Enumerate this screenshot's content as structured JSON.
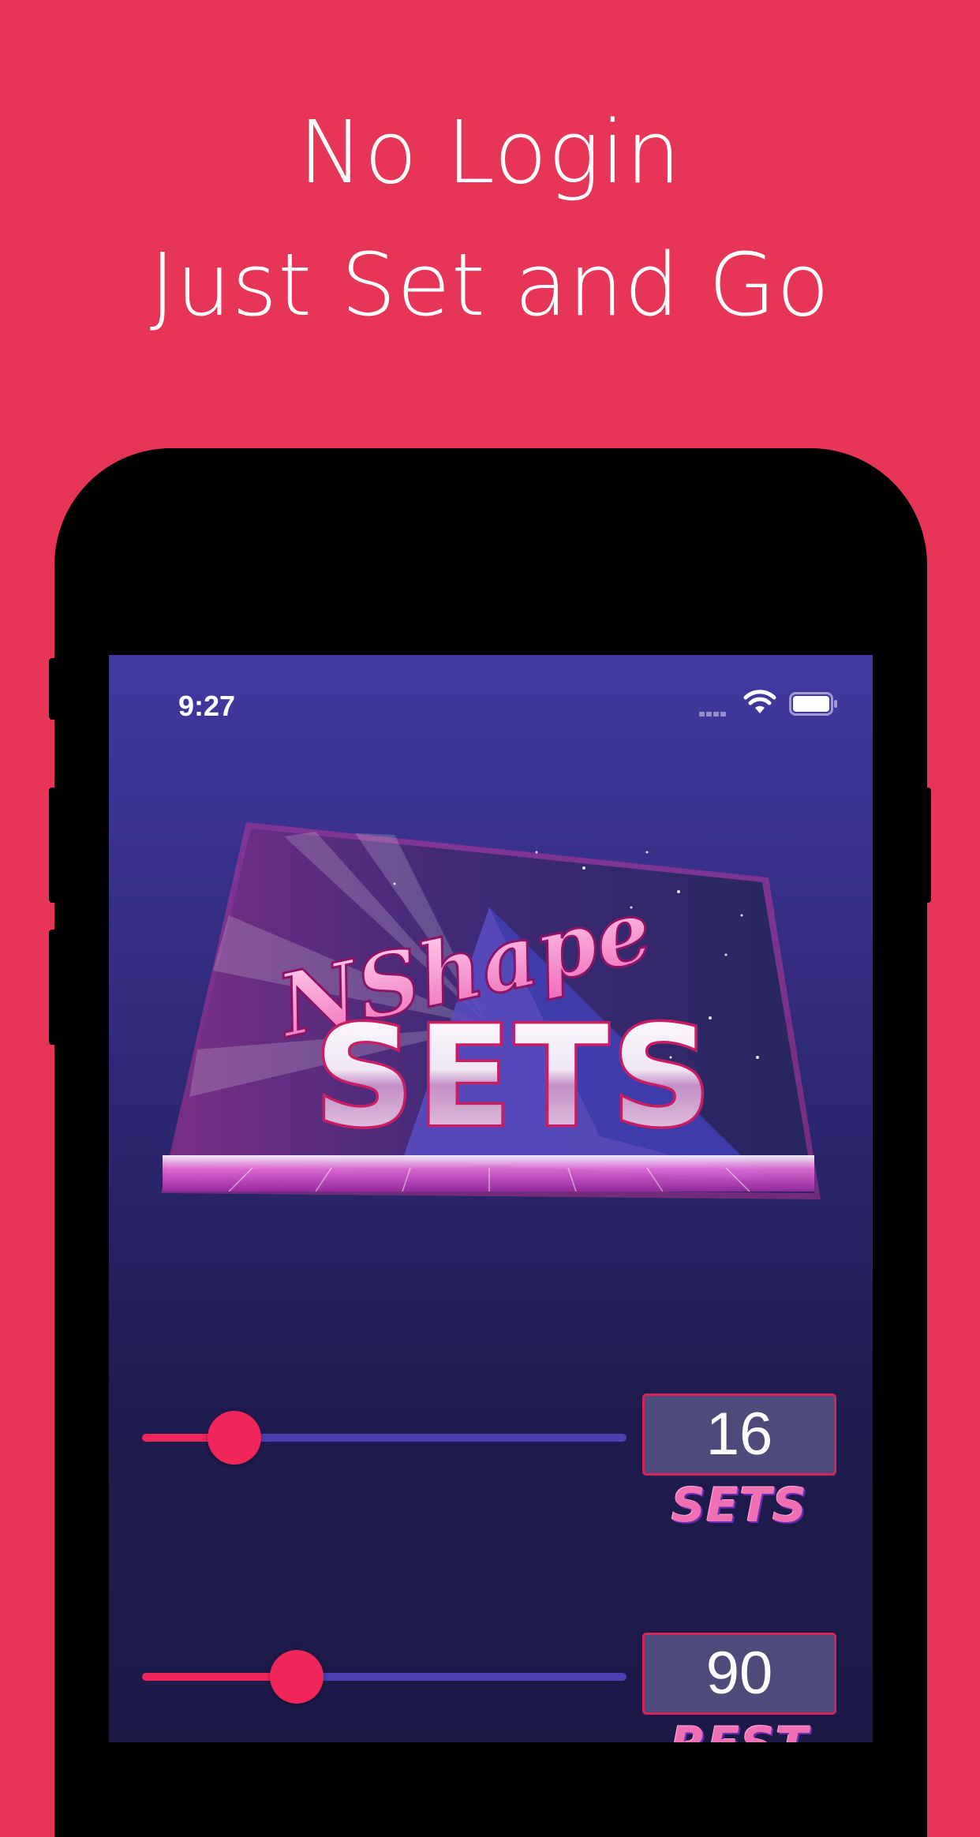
{
  "headline": {
    "line1": "No Login",
    "line2": "Just Set and Go"
  },
  "colors": {
    "background": "#e63557",
    "accent": "#f0255a",
    "track": "#4c3fb0",
    "value_box": "#4e4a7a"
  },
  "status_bar": {
    "time": "9:27",
    "icons": [
      "cellular-signal-icon",
      "wifi-icon",
      "battery-icon"
    ]
  },
  "logo": {
    "script": "NShape",
    "title": "SETS"
  },
  "controls": [
    {
      "value": "16",
      "caption": "SETS",
      "slider_fraction": 0.19
    },
    {
      "value": "90",
      "caption": "REST",
      "slider_fraction": 0.32
    }
  ]
}
